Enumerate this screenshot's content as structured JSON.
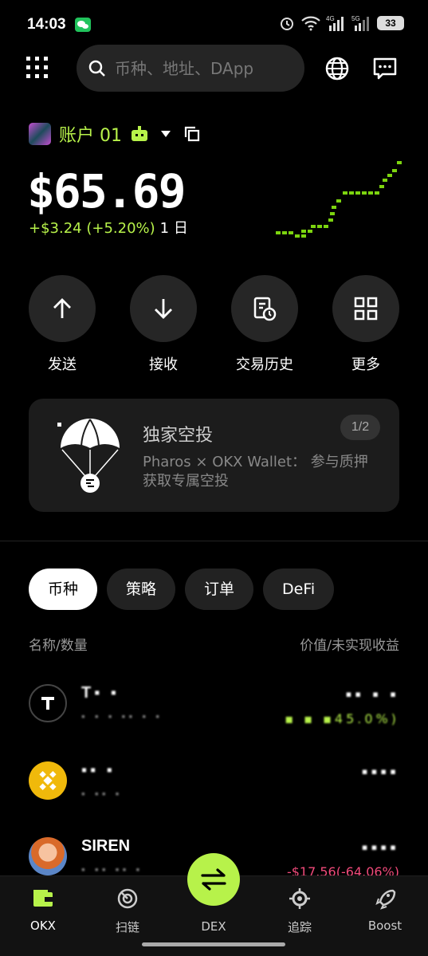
{
  "status": {
    "time": "14:03",
    "battery": "33",
    "net1": "4G",
    "net2": "5G"
  },
  "search": {
    "placeholder": "币种、地址、DApp"
  },
  "account": {
    "name": "账户 01"
  },
  "balance": {
    "amount": "$65.69",
    "change": "+$3.24 (+5.20%)",
    "period": "1 日"
  },
  "actions": [
    {
      "label": "发送",
      "icon": "arrow-up-icon"
    },
    {
      "label": "接收",
      "icon": "arrow-down-icon"
    },
    {
      "label": "交易历史",
      "icon": "history-icon"
    },
    {
      "label": "更多",
      "icon": "grid-icon"
    }
  ],
  "banner": {
    "title": "独家空投",
    "body": "Pharos × OKX Wallet： 参与质押获取专属空投",
    "pager": "1/2"
  },
  "tabs": [
    {
      "label": "币种",
      "active": true
    },
    {
      "label": "策略",
      "active": false
    },
    {
      "label": "订单",
      "active": false
    },
    {
      "label": "DeFi",
      "active": false
    }
  ],
  "list_header": {
    "left": "名称/数量",
    "right": "价值/未实现收益"
  },
  "tokens": [
    {
      "name": "T▪ ▪",
      "qty": "▪ ▪ ▪ ▪▪ ▪ ▪",
      "value": "▪▪ ▪ ▪",
      "pnl": "▪ ▪ ▪45.0%)",
      "pnl_sign": "pos"
    },
    {
      "name": "▪▪ ▪",
      "qty": "▪ ▪▪ ▪",
      "value": "▪▪▪▪",
      "pnl": "",
      "pnl_sign": "pos"
    },
    {
      "name": "SIREN",
      "qty": "▪ ▪▪ ▪▪ ▪",
      "value": "▪▪▪▪",
      "pnl": "-$17.56(-64.06%)",
      "pnl_sign": "neg"
    }
  ],
  "nav": [
    {
      "label": "OKX",
      "icon": "wallet-icon"
    },
    {
      "label": "扫链",
      "icon": "radar-icon"
    },
    {
      "label": "DEX",
      "icon": "swap-icon"
    },
    {
      "label": "追踪",
      "icon": "crosshair-icon"
    },
    {
      "label": "Boost",
      "icon": "rocket-icon"
    }
  ]
}
